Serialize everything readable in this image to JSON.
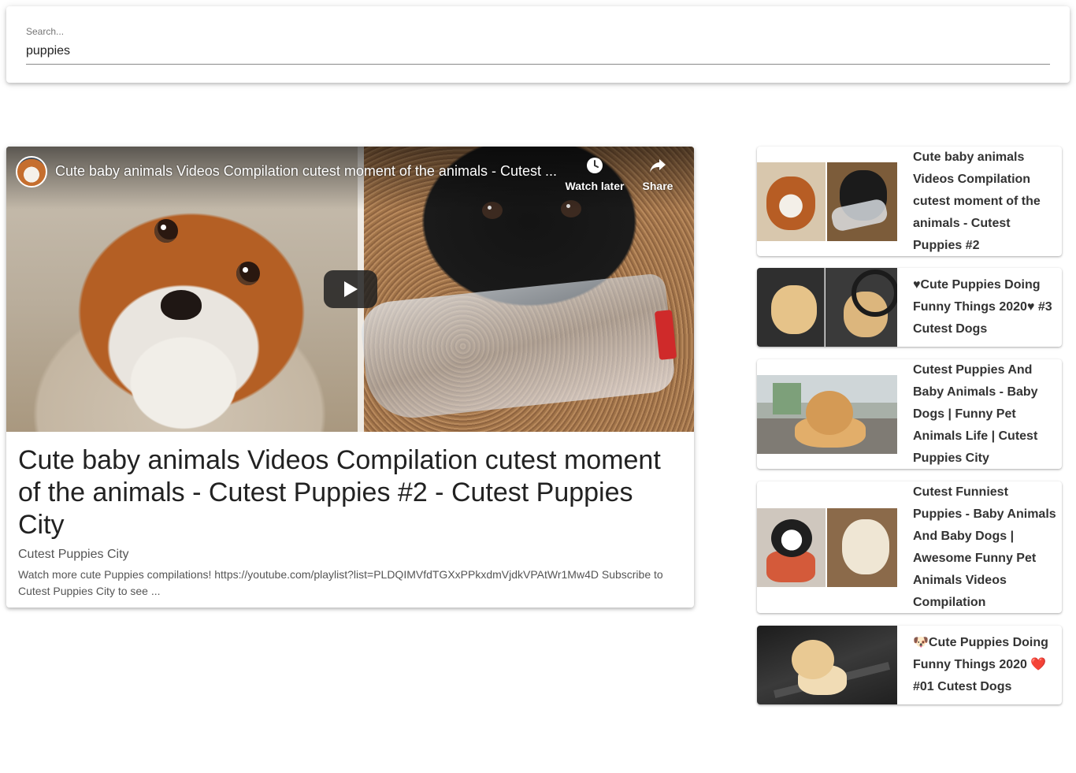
{
  "search": {
    "label": "Search...",
    "value": "puppies"
  },
  "player": {
    "title": "Cute baby animals Videos Compilation cutest moment of the animals - Cutest ...",
    "watch_later_label": "Watch later",
    "share_label": "Share"
  },
  "main_video": {
    "title": "Cute baby animals Videos Compilation cutest moment of the animals - Cutest Puppies #2 - Cutest Puppies City",
    "channel": "Cutest Puppies City",
    "description": "Watch more cute Puppies compilations! https://youtube.com/playlist?list=PLDQIMVfdTGXxPPkxdmVjdkVPAtWr1Mw4D Subscribe to Cutest Puppies City to see ..."
  },
  "video_list": [
    {
      "title": "Cute baby animals Videos Compilation cutest moment of the animals - Cutest Puppies #2"
    },
    {
      "title": "♥Cute Puppies Doing Funny Things 2020♥ #3 Cutest Dogs"
    },
    {
      "title": "Cutest Puppies And Baby Animals - Baby Dogs | Funny Pet Animals Life | Cutest Puppies City"
    },
    {
      "title": "Cutest Funniest Puppies - Baby Animals And Baby Dogs | Awesome Funny Pet Animals Videos Compilation"
    },
    {
      "title": "🐶Cute Puppies Doing Funny Things 2020 ❤️ #01 Cutest Dogs"
    }
  ],
  "icons": [
    "clock-icon",
    "share-icon",
    "play-icon"
  ],
  "colors": {
    "play_button": "#212121",
    "text": "#222222",
    "muted_text": "#555555"
  }
}
